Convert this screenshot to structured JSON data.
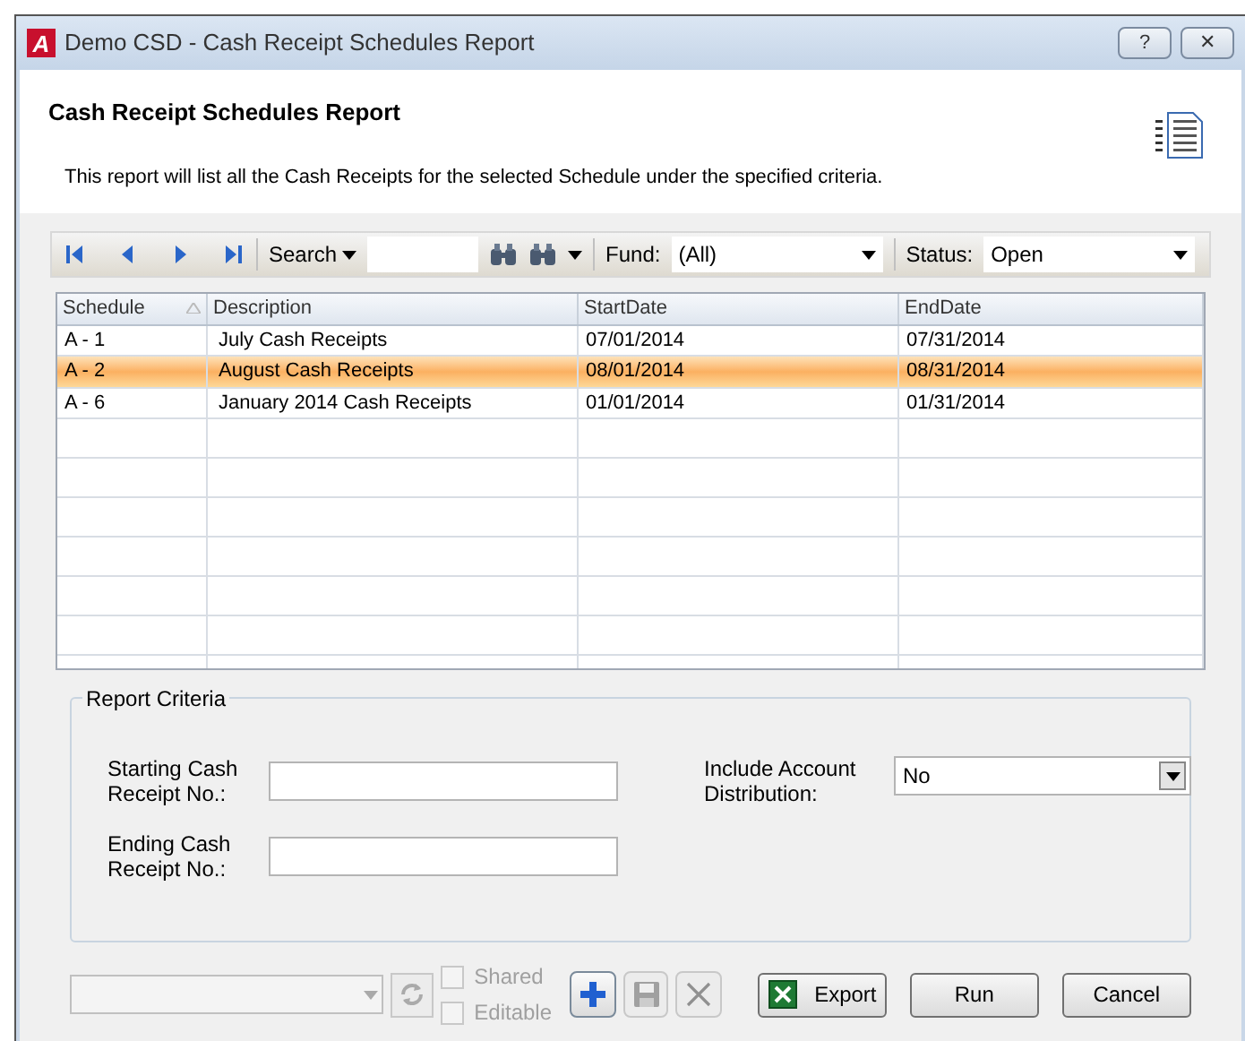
{
  "window": {
    "title": "Demo CSD - Cash Receipt Schedules Report",
    "logo": "A",
    "buttons": [
      "?",
      "✕"
    ]
  },
  "header": {
    "title": "Cash Receipt Schedules Report",
    "description": "This report will list all the Cash Receipts for the selected Schedule under the specified criteria."
  },
  "toolbar": {
    "search_label": "Search",
    "fund_label": "Fund:",
    "fund_value": "(All)",
    "status_label": "Status:",
    "status_value": "Open"
  },
  "table": {
    "columns": [
      "Schedule",
      "Description",
      "StartDate",
      "EndDate"
    ],
    "rows": [
      {
        "cells": [
          "A - 1",
          "July Cash Receipts",
          "07/01/2014",
          "07/31/2014"
        ],
        "selected": false
      },
      {
        "cells": [
          "A - 2",
          "August Cash Receipts",
          "08/01/2014",
          "08/31/2014"
        ],
        "selected": true
      },
      {
        "cells": [
          "A - 6",
          "January 2014 Cash Receipts",
          "01/01/2014",
          "01/31/2014"
        ],
        "selected": false
      }
    ]
  },
  "criteria": {
    "title": "Report Criteria",
    "starting_label": "Starting Cash Receipt No.:",
    "ending_label": "Ending Cash Receipt No.:",
    "distribution_label": "Include Account Distribution:",
    "distribution_value": "No"
  },
  "footer": {
    "checkboxes": [
      {
        "label": "Shared",
        "checked": false,
        "disabled": true
      },
      {
        "label": "Editable",
        "checked": false,
        "disabled": true
      }
    ],
    "icon_buttons": [
      {
        "kind": "add",
        "disabled": false
      },
      {
        "kind": "save",
        "disabled": true
      },
      {
        "kind": "delete",
        "disabled": true
      }
    ],
    "export": "Export",
    "run": "Run",
    "cancel": "Cancel"
  }
}
